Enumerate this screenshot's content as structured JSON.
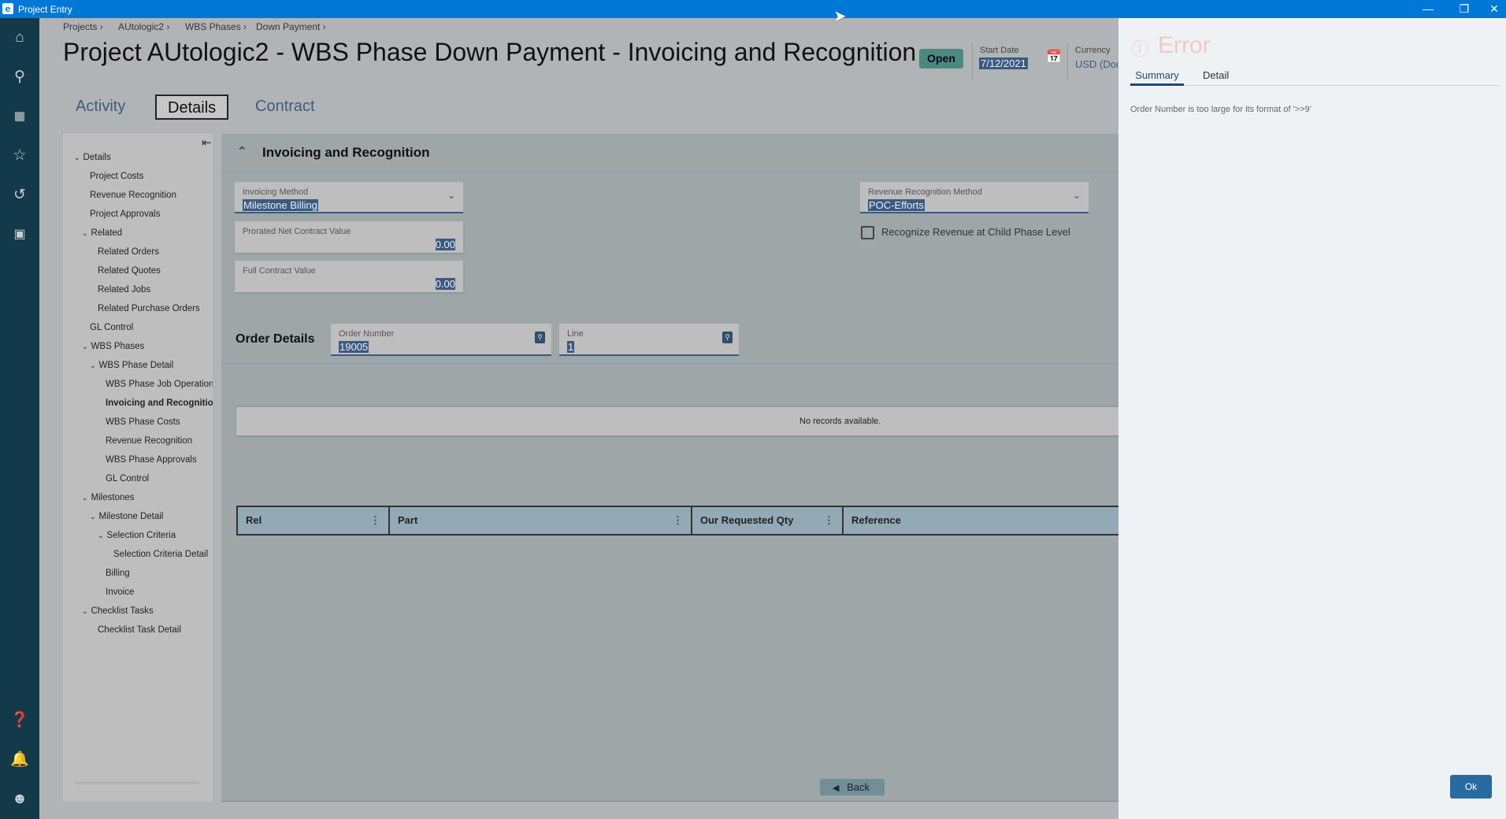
{
  "window": {
    "title": "Project Entry",
    "controls": [
      "minimize",
      "restore",
      "close"
    ]
  },
  "rail": {
    "top_icons": [
      "home-icon",
      "search-icon",
      "apps-icon",
      "star-icon",
      "history-icon",
      "dashboard-icon"
    ],
    "bottom_icons": [
      "help-icon",
      "bell-icon",
      "user-icon"
    ]
  },
  "breadcrumb": [
    "Projects",
    "AUtologic2",
    "WBS Phases",
    "Down Payment"
  ],
  "header": {
    "title": "Project AUtologic2 - WBS Phase Down Payment - Invoicing and Recognition",
    "status": "Open",
    "status_color": "#4a8a7c",
    "start_date_label": "Start Date",
    "start_date": "7/12/2021",
    "currency_label": "Currency",
    "currency": "USD (Doc"
  },
  "tabs": [
    {
      "label": "Activity"
    },
    {
      "label": "Details",
      "active": true
    },
    {
      "label": "Contract"
    }
  ],
  "tree": [
    {
      "label": "Details",
      "level": 0,
      "expanded": true
    },
    {
      "label": "Project Costs",
      "level": 1
    },
    {
      "label": "Revenue Recognition",
      "level": 1
    },
    {
      "label": "Project Approvals",
      "level": 1
    },
    {
      "label": "Related",
      "level": 1,
      "expanded": true
    },
    {
      "label": "Related Orders",
      "level": 2
    },
    {
      "label": "Related Quotes",
      "level": 2
    },
    {
      "label": "Related Jobs",
      "level": 2
    },
    {
      "label": "Related Purchase Orders",
      "level": 2
    },
    {
      "label": "GL Control",
      "level": 1
    },
    {
      "label": "WBS Phases",
      "level": 1,
      "expanded": true
    },
    {
      "label": "WBS Phase Detail",
      "level": 2,
      "expanded": true
    },
    {
      "label": "WBS Phase Job Operation",
      "level": 3
    },
    {
      "label": "Invoicing and Recognition",
      "level": 3,
      "active": true
    },
    {
      "label": "WBS Phase Costs",
      "level": 3
    },
    {
      "label": "Revenue Recognition",
      "level": 3
    },
    {
      "label": "WBS Phase Approvals",
      "level": 3
    },
    {
      "label": "GL Control",
      "level": 3
    },
    {
      "label": "Milestones",
      "level": 1,
      "expanded": true
    },
    {
      "label": "Milestone Detail",
      "level": 2,
      "expanded": true
    },
    {
      "label": "Selection Criteria",
      "level": 3,
      "expanded": true
    },
    {
      "label": "Selection Criteria Detail",
      "level": 4
    },
    {
      "label": "Billing",
      "level": 3
    },
    {
      "label": "Invoice",
      "level": 3
    },
    {
      "label": "Checklist Tasks",
      "level": 1,
      "expanded": true
    },
    {
      "label": "Checklist Task Detail",
      "level": 2
    }
  ],
  "section": {
    "title": "Invoicing and Recognition"
  },
  "form": {
    "invoicing_method": {
      "label": "Invoicing Method",
      "value": "Milestone Billing"
    },
    "prorated_net": {
      "label": "Prorated Net Contract Value",
      "value": "0.00"
    },
    "full_contract": {
      "label": "Full Contract Value",
      "value": "0.00"
    },
    "revenue_method": {
      "label": "Revenue Recognition Method",
      "value": "POC-Efforts"
    },
    "child_phase": {
      "label": "Recognize Revenue at Child Phase Level",
      "checked": false
    }
  },
  "order_details": {
    "title": "Order Details",
    "order_number": {
      "label": "Order Number",
      "value": "19005"
    },
    "line": {
      "label": "Line",
      "value": "1"
    }
  },
  "grid": {
    "columns": [
      "Rel",
      "Part",
      "Our Requested Qty",
      "Reference"
    ],
    "empty_text": "No records available."
  },
  "footer": {
    "back_label": "Back"
  },
  "error": {
    "title": "Error",
    "tabs": [
      "Summary",
      "Detail"
    ],
    "active_tab": "Summary",
    "message": "Order Number is too large for its format of '>>9'",
    "ok_label": "Ok",
    "accent": "#f6c9c2"
  }
}
